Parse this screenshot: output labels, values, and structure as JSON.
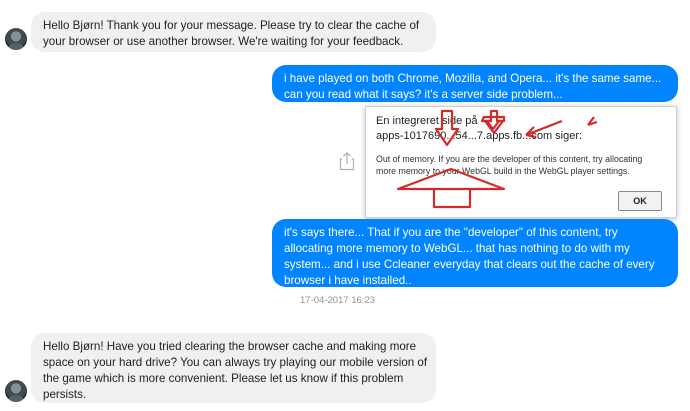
{
  "messages": [
    {
      "from": "other",
      "lines": [
        "Hello Bjørn! Thank you for your message. Please try to clear the cache of",
        "your browser or use another browser. We're waiting for your feedback."
      ]
    },
    {
      "from": "me",
      "lines": [
        "i have played on both Chrome, Mozilla, and Opera... it's the same same...",
        "can you read what it says? it's a server side problem..."
      ]
    },
    {
      "from": "me",
      "lines": [
        "it's says there... That if you are the \"developer\" of this content, try",
        "allocating more memory to WebGL... that has nothing to do with my",
        "system... and i use Ccleaner everyday that clears out the cache of every",
        "browser i have installed.."
      ]
    },
    {
      "from": "other",
      "lines": [
        "Hello Bjørn! Have you tried clearing the browser cache and making more",
        "space on your hard drive? You can always try playing our mobile version of",
        "the game which is more convenient. Please let us know if this problem",
        "persists."
      ]
    }
  ],
  "timestamp": "17-04-2017 16:23",
  "dialog": {
    "title": "En integreret side på",
    "origin": "apps-1017690...54...7.apps.fb...com siger:",
    "message_lines": [
      "Out of memory. If you are the developer of this content, try allocating",
      "more memory to your WebGL build in the WebGL player settings."
    ],
    "ok_label": "OK"
  },
  "colors": {
    "outgoing_bubble": "#0084ff",
    "incoming_bubble": "#f1f0f0",
    "annotation_arrow": "#d42a2a"
  },
  "icons": [
    "avatar",
    "share-icon"
  ]
}
